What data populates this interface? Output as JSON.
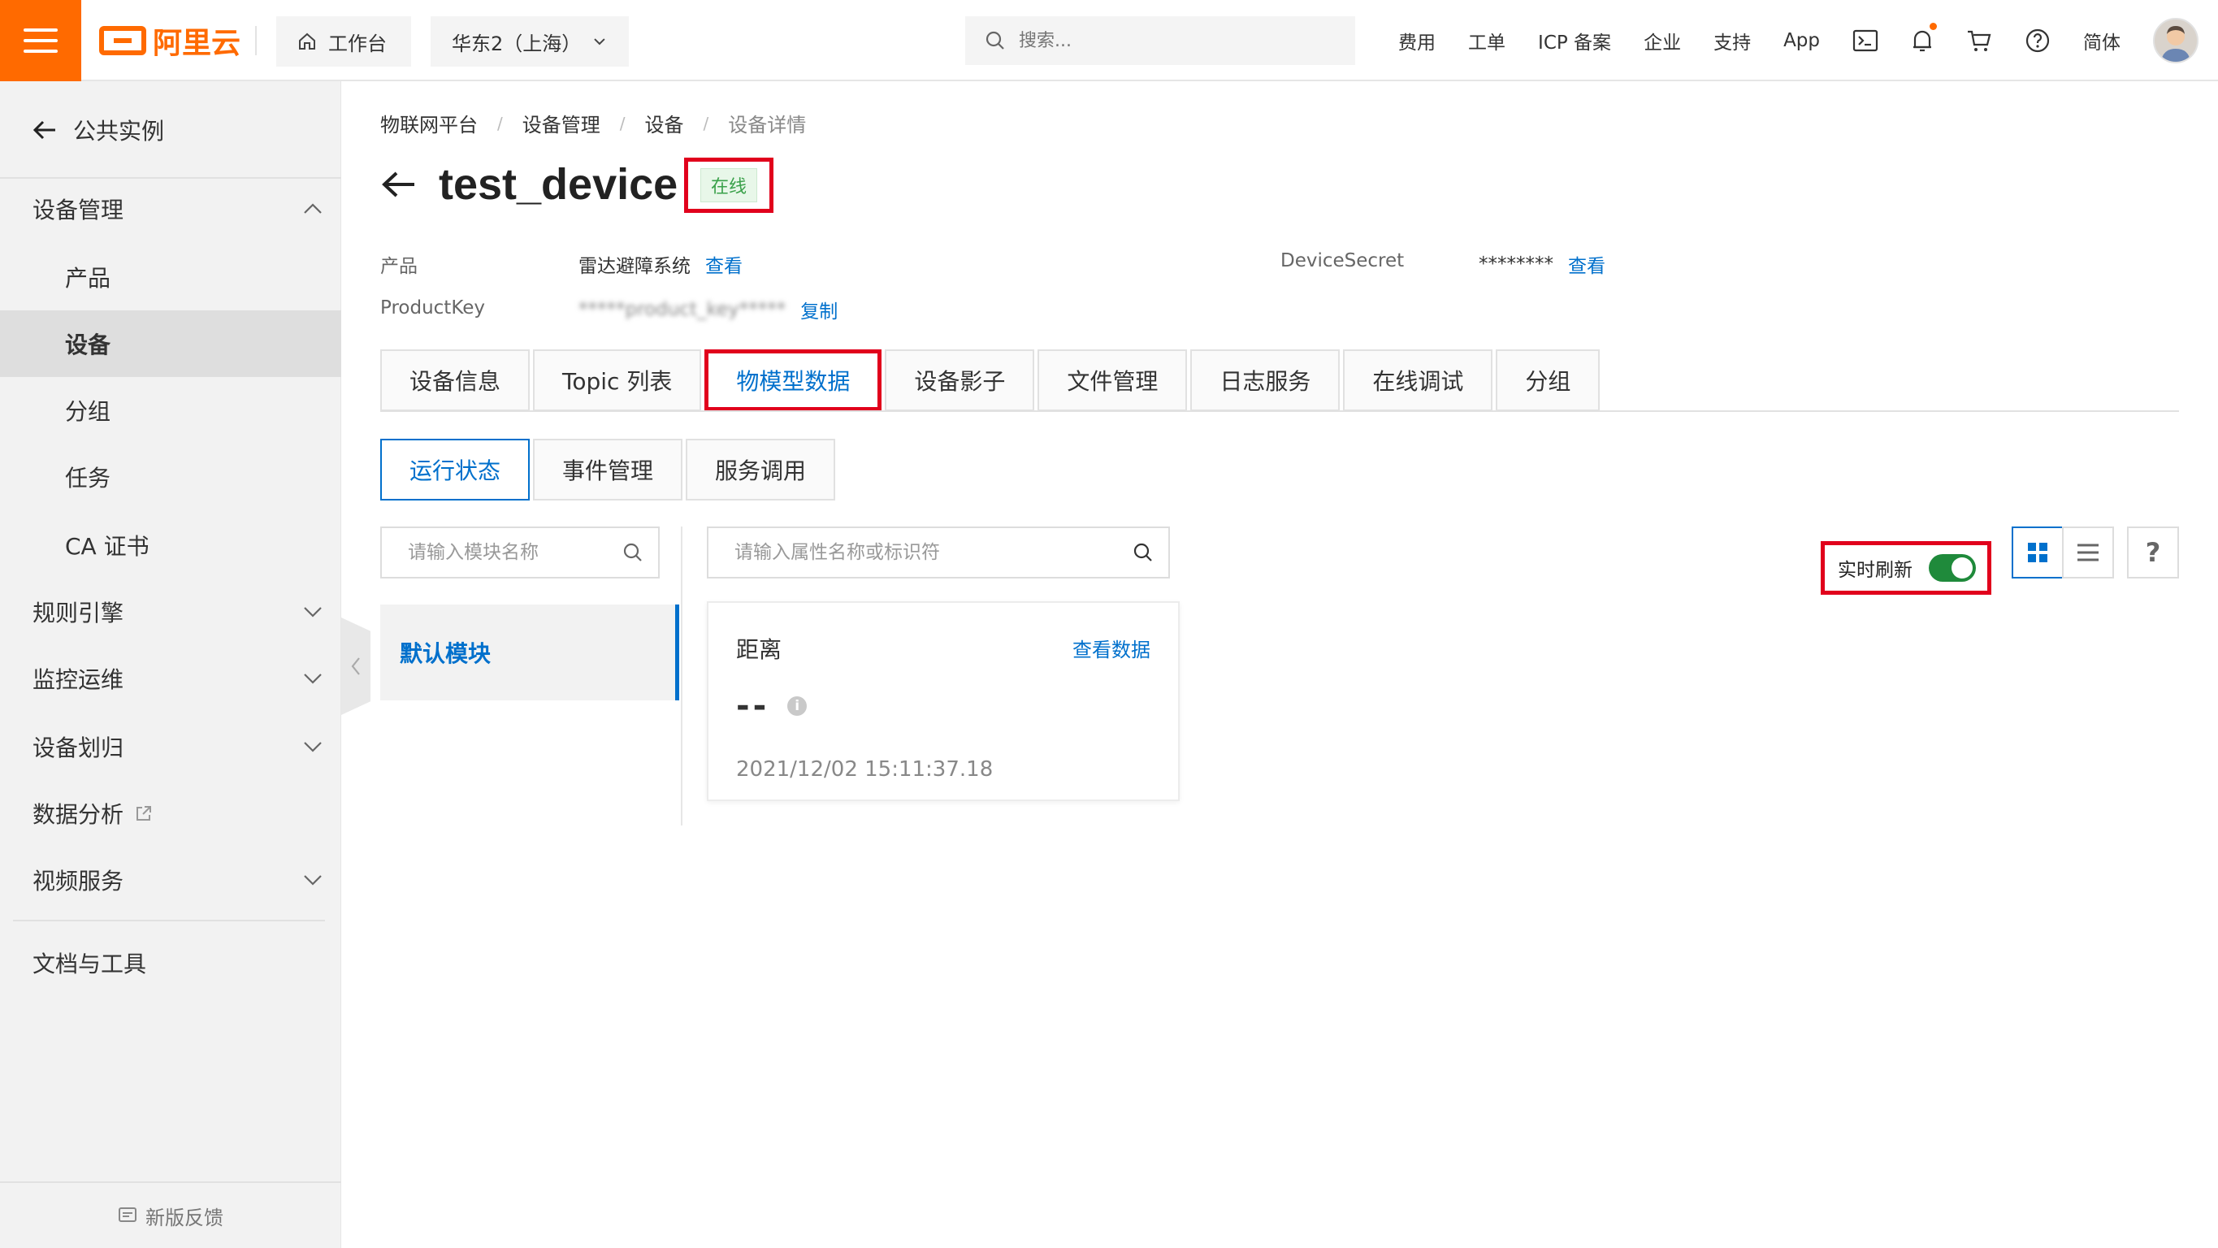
{
  "topbar": {
    "logo_text": "阿里云",
    "workbench": "工作台",
    "region": "华东2（上海）",
    "search_placeholder": "搜索...",
    "links": [
      "费用",
      "工单",
      "ICP 备案",
      "企业",
      "支持",
      "App"
    ],
    "language": "简体"
  },
  "sidebar": {
    "back_label": "公共实例",
    "device_mgmt": "设备管理",
    "sub_items": [
      "产品",
      "设备",
      "分组",
      "任务",
      "CA 证书"
    ],
    "rules": "规则引擎",
    "monitoring": "监控运维",
    "device_assign": "设备划归",
    "data_analysis": "数据分析",
    "video": "视频服务",
    "docs": "文档与工具",
    "feedback": "新版反馈"
  },
  "breadcrumb": [
    "物联网平台",
    "设备管理",
    "设备",
    "设备详情"
  ],
  "device": {
    "name": "test_device",
    "status": "在线",
    "product_label": "产品",
    "product_value": "雷达避障系统",
    "view_link": "查看",
    "productkey_label": "ProductKey",
    "productkey_value": "*****product_key*****",
    "copy_link": "复制",
    "secret_label": "DeviceSecret",
    "secret_value": "********",
    "secret_view_link": "查看"
  },
  "tabs": [
    "设备信息",
    "Topic 列表",
    "物模型数据",
    "设备影子",
    "文件管理",
    "日志服务",
    "在线调试",
    "分组"
  ],
  "active_tab": "物模型数据",
  "subtabs": [
    "运行状态",
    "事件管理",
    "服务调用"
  ],
  "module_search_placeholder": "请输入模块名称",
  "property_search_placeholder": "请输入属性名称或标识符",
  "default_module": "默认模块",
  "property": {
    "name": "距离",
    "view_data": "查看数据",
    "value": "--",
    "time": "2021/12/02 15:11:37.18"
  },
  "realtime_label": "实时刷新",
  "realtime_on": true,
  "help": "?",
  "colors": {
    "brand": "#ff6a00",
    "link": "#0070cc",
    "highlight": "#e1001c",
    "online": "#3aa14a",
    "toggle": "#1f8a3b"
  }
}
